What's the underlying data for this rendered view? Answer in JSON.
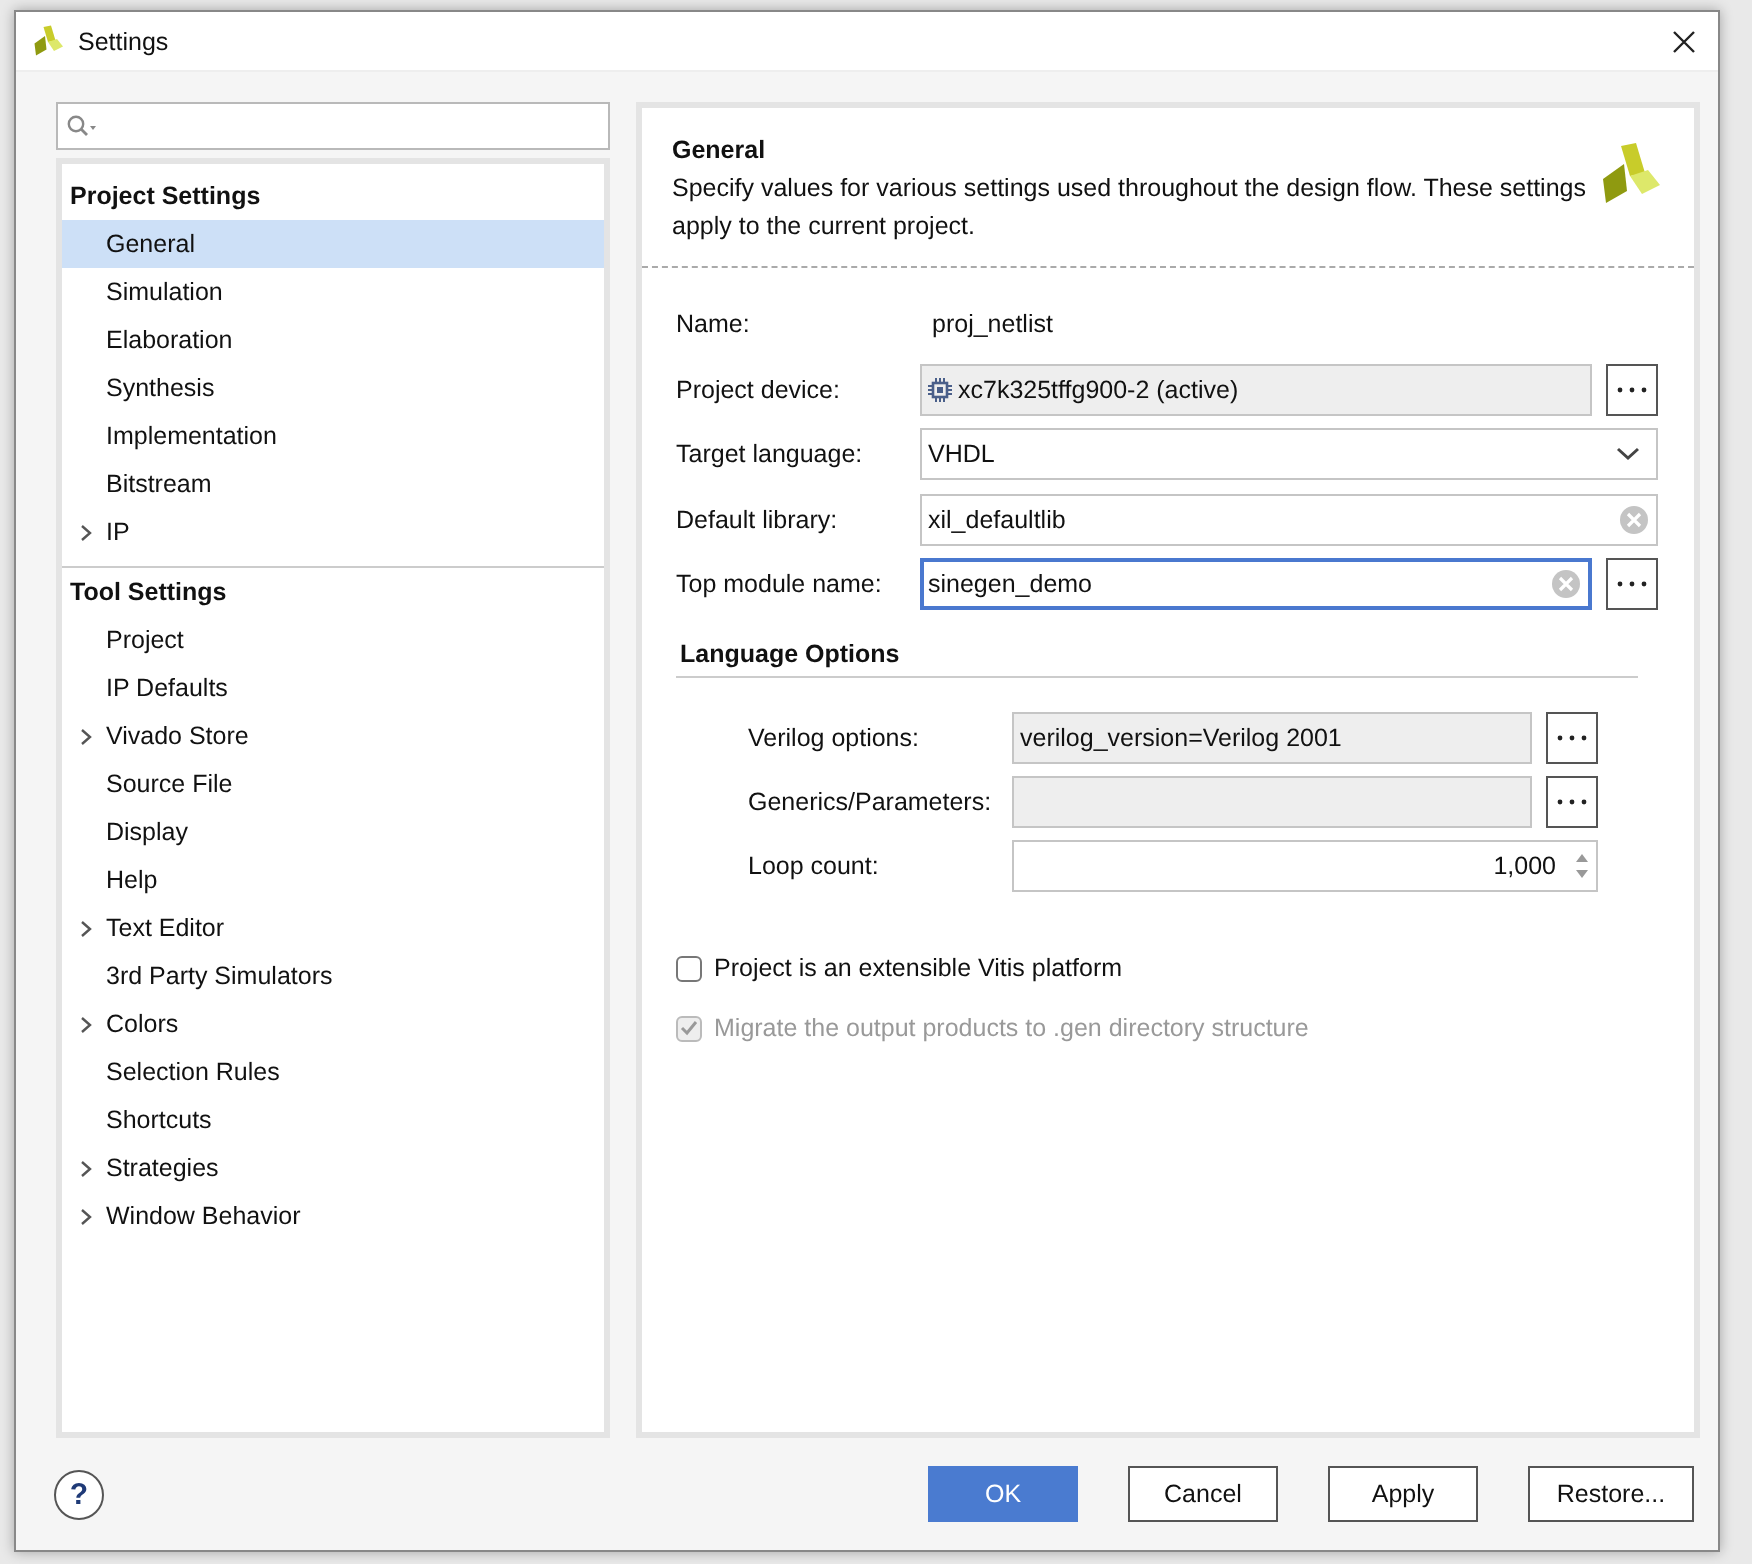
{
  "window": {
    "title": "Settings"
  },
  "tree": [
    {
      "title": "Project Settings",
      "items": [
        {
          "label": "General",
          "kind": "leaf",
          "selected": true
        },
        {
          "label": "Simulation",
          "kind": "leaf",
          "selected": false
        },
        {
          "label": "Elaboration",
          "kind": "leaf",
          "selected": false
        },
        {
          "label": "Synthesis",
          "kind": "leaf",
          "selected": false
        },
        {
          "label": "Implementation",
          "kind": "leaf",
          "selected": false
        },
        {
          "label": "Bitstream",
          "kind": "leaf",
          "selected": false
        },
        {
          "label": "IP",
          "kind": "group",
          "selected": false
        }
      ]
    },
    {
      "title": "Tool Settings",
      "items": [
        {
          "label": "Project",
          "kind": "leaf",
          "selected": false
        },
        {
          "label": "IP Defaults",
          "kind": "leaf",
          "selected": false
        },
        {
          "label": "Vivado Store",
          "kind": "group",
          "selected": false
        },
        {
          "label": "Source File",
          "kind": "leaf",
          "selected": false
        },
        {
          "label": "Display",
          "kind": "leaf",
          "selected": false
        },
        {
          "label": "Help",
          "kind": "leaf",
          "selected": false
        },
        {
          "label": "Text Editor",
          "kind": "group",
          "selected": false
        },
        {
          "label": "3rd Party Simulators",
          "kind": "leaf",
          "selected": false
        },
        {
          "label": "Colors",
          "kind": "group",
          "selected": false
        },
        {
          "label": "Selection Rules",
          "kind": "leaf",
          "selected": false
        },
        {
          "label": "Shortcuts",
          "kind": "leaf",
          "selected": false
        },
        {
          "label": "Strategies",
          "kind": "group",
          "selected": false
        },
        {
          "label": "Window Behavior",
          "kind": "group",
          "selected": false
        }
      ]
    }
  ],
  "panel": {
    "title": "General",
    "description": "Specify values for various settings used throughout the design flow. These settings apply to the current project.",
    "fields": [
      {
        "kind": "text",
        "label": "Name:",
        "value": "proj_netlist"
      },
      {
        "kind": "device",
        "label": "Project device:",
        "value": "xc7k325tffg900-2 (active)",
        "browse": true
      },
      {
        "kind": "dropdown",
        "label": "Target language:",
        "value": "VHDL"
      },
      {
        "kind": "input",
        "label": "Default library:",
        "value": "xil_defaultlib",
        "browse": false,
        "clearable": true,
        "focused": false
      },
      {
        "kind": "input",
        "label": "Top module name:",
        "value": "sinegen_demo",
        "browse": true,
        "clearable": true,
        "focused": true
      }
    ],
    "language_options": {
      "title": "Language Options",
      "fields": [
        {
          "kind": "readonly",
          "label": "Verilog options:",
          "value": "verilog_version=Verilog 2001",
          "browse": true
        },
        {
          "kind": "readonly",
          "label": "Generics/Parameters:",
          "browse": true
        },
        {
          "kind": "spinner",
          "label": "Loop count:",
          "value": "1,000"
        }
      ]
    },
    "checkboxes": [
      {
        "label": "Project is an extensible Vitis platform",
        "checked": false,
        "disabled": false
      },
      {
        "label": "Migrate the output products to .gen directory structure",
        "checked": true,
        "disabled": true
      }
    ]
  },
  "help": {
    "label": "?"
  },
  "buttons": [
    {
      "label": "OK",
      "kind": "primary"
    },
    {
      "label": "Cancel",
      "kind": "normal"
    },
    {
      "label": "Apply",
      "kind": "normal"
    },
    {
      "label": "Restore...",
      "kind": "normal"
    }
  ]
}
